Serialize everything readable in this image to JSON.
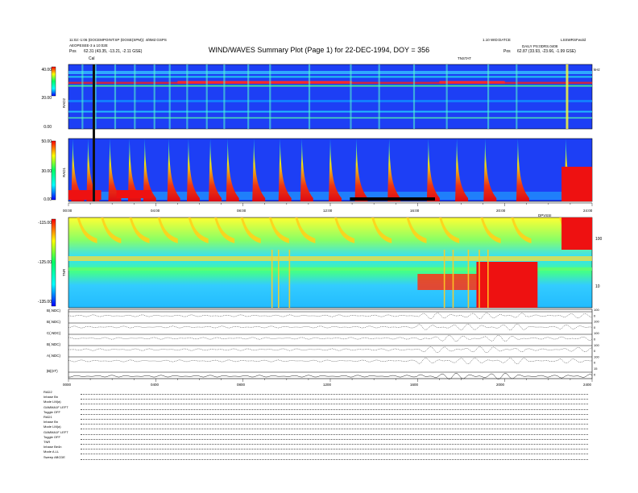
{
  "header": {
    "title": "WIND/WAVES Summary Plot (Page 1) for 22-DEC-1994, DOY = 356",
    "left_line1": "11:02:-1:06 (DOCEMPOINT:SP (DOSE(SPM)): 4/8M2:GSPS",
    "left_line2": "AEOPESEE-3 a 10:02E",
    "left_line3_label": "Pos",
    "left_line3_value": "62.31 (43.35, -13.21, -2.11 GSE)",
    "right_line1": "1.10 WID:DATCE",
    "right_line2": "DAILY PS:0DRS.0408",
    "right_line3_label": "Pos",
    "right_line3_value": "62.87 (33.93, -23.66, -1.99 GSE)",
    "right_corner": "LSSWRSFwold",
    "cal_label": "Cal",
    "mid_marker": "TNSTAT"
  },
  "colors": {
    "background": "#ffffff",
    "spectrogram_base": "#1e3cff",
    "burst_red": "#e8121a",
    "axis": "#000000"
  },
  "chart_data": [
    {
      "type": "heatmap",
      "name_label": "RAD2",
      "yticks": [
        "40.00",
        "20.00",
        "0.00"
      ],
      "ylim": [
        0,
        40
      ],
      "colorbar": [
        "red",
        "yellow",
        "green",
        "cyan",
        "blue"
      ],
      "burst_hours": [
        0.6,
        1.2,
        2.1,
        3.0,
        3.9,
        4.6,
        5.4,
        6.3,
        7.1,
        8.2,
        9.2,
        11.0,
        12.9,
        14.2,
        15.8,
        17.3,
        19.2,
        20.5,
        22.8
      ],
      "emission_bands_pct": [
        0.2,
        0.3,
        0.75
      ]
    },
    {
      "type": "heatmap",
      "name_label": "RAD1",
      "yticks": [
        "50.00",
        "30.00",
        "0.00"
      ],
      "ylim": [
        0,
        50
      ],
      "colorbar": [
        "red",
        "yellow",
        "green",
        "cyan",
        "blue"
      ],
      "xticks": [
        "00:00",
        "04:00",
        "08:00",
        "12:00",
        "16:00",
        "20:00",
        "24:00"
      ],
      "burst_hours": [
        0.2,
        0.9,
        1.9,
        2.8,
        3.5,
        4.6,
        5.5,
        6.5,
        7.3,
        8.5,
        9.7,
        10.7,
        12.0,
        13.2,
        14.7,
        16.5,
        17.8,
        19.1,
        20.6,
        22.8
      ]
    },
    {
      "type": "heatmap",
      "name_label": "TNR",
      "yticks": [
        "-115.00",
        "-125.00",
        "-135.00"
      ],
      "right_ticks": [
        "100",
        "10"
      ],
      "xlabel_right": "DPVSSI",
      "x_end_label": "kHz",
      "burst_hours": [
        0.5,
        1.6,
        2.9,
        4.2,
        5.6,
        6.8,
        8.0,
        9.3,
        10.5,
        12.3,
        14.0,
        15.6,
        17.1,
        19.0,
        20.4,
        22.6
      ]
    },
    {
      "type": "line",
      "series": [
        {
          "name": "B(.NDC)"
        },
        {
          "name": "B(.NDC)"
        },
        {
          "name": "C(.NDC)"
        },
        {
          "name": "B(.NDC)"
        },
        {
          "name": "A(.NDC)"
        },
        {
          "name": "|B|(nT)"
        }
      ],
      "xticks": [
        "0000",
        "0400",
        "0800",
        "1200",
        "1600",
        "2000",
        "2400"
      ],
      "right_ticks": [
        "100",
        "0",
        "100",
        "0",
        "100",
        "0",
        "100",
        "0",
        "100",
        "0",
        "15",
        "0"
      ]
    }
  ],
  "footer": {
    "rows": [
      "RAD2",
      "Inhase         Bn",
      "Mode           LM(a)",
      "GAMMA1F  LEFT",
      "Toggle          OFF",
      "RAD1",
      "Inhase         Bn",
      "Mode           LM(a)",
      "GAMMA1F  LEFT",
      "Toggle          OFF",
      "TNR",
      "Inhase         Be4n",
      "Mode           A.LL",
      "Sweep    ABCDE"
    ]
  }
}
